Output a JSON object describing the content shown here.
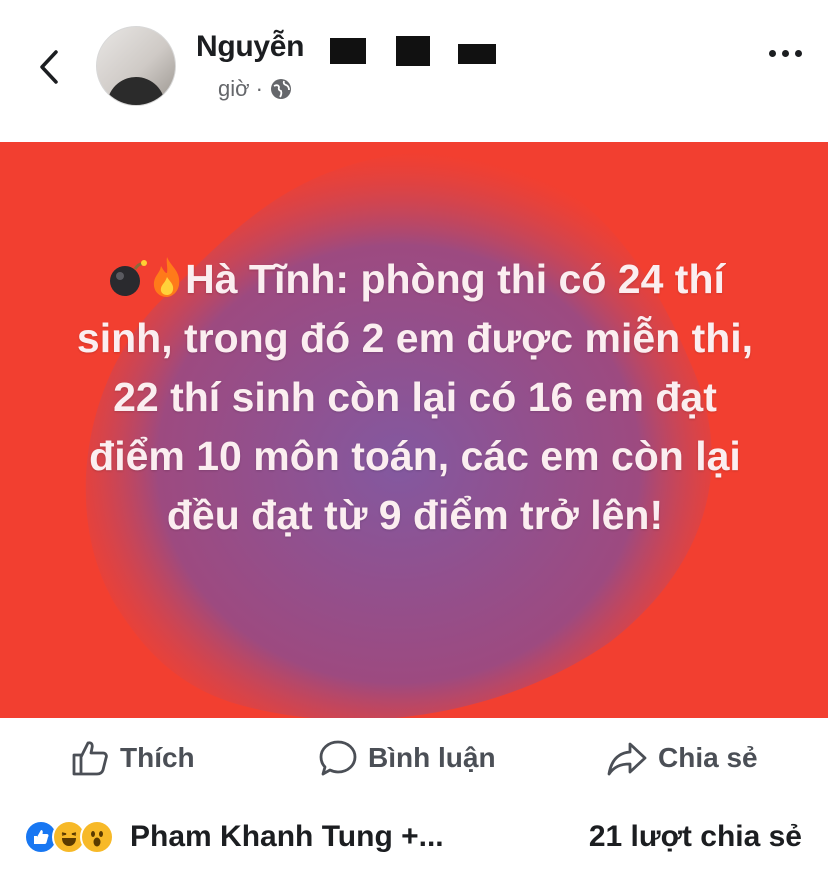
{
  "header": {
    "author_name": "Nguyễn",
    "time": "giờ",
    "separator": "·",
    "privacy_icon": "globe-icon",
    "back_icon": "chevron-left-icon",
    "more_icon": "more-dots-icon"
  },
  "post": {
    "emoji_icons": [
      "bomb-icon",
      "fire-icon"
    ],
    "text": "Hà Tĩnh: phòng thi có 24 thí sinh, trong đó 2 em được miễn thi, 22 thí sinh còn lại có 16 em đạt điểm 10 môn toán, các em còn lại đều đạt từ 9 điểm trở lên!",
    "background_color": "#f23f30",
    "blob_color": "#7b5fa8"
  },
  "actions": {
    "like": "Thích",
    "comment": "Bình luận",
    "share": "Chia sẻ"
  },
  "footer": {
    "reaction_icons": [
      "like-reaction-icon",
      "haha-reaction-icon",
      "wow-reaction-icon"
    ],
    "reactors": "Pham Khanh Tung +...",
    "share_count": "21 lượt chia sẻ"
  }
}
